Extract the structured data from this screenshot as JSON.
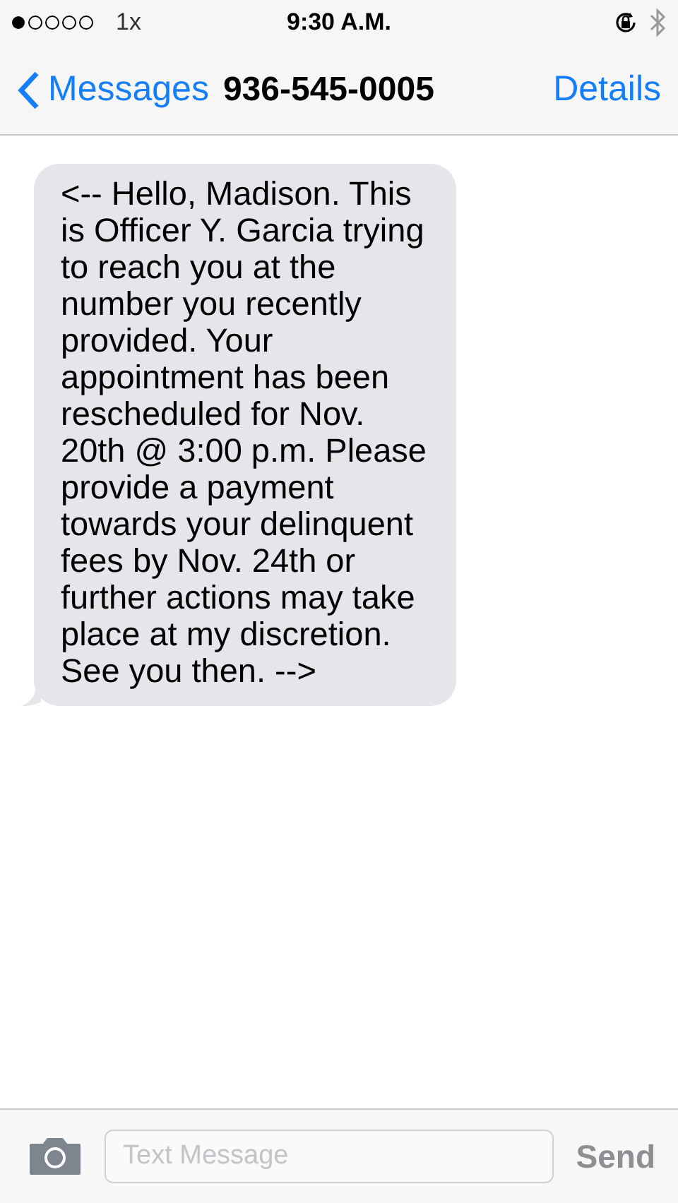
{
  "status_bar": {
    "carrier": "1x",
    "time": "9:30 A.M."
  },
  "nav_bar": {
    "back": "Messages",
    "title": "936-545-0005",
    "action": "Details"
  },
  "messages": [
    {
      "kind": "received",
      "text": "<-- Hello, Madison. This is Officer Y. Garcia trying to reach you at the number you recently provided. Your appointment has been rescheduled for Nov. 20th @ 3:00 p.m. Please provide a payment towards your delinquent fees by Nov. 24th or further actions may take place at my discretion. See you then. -->"
    }
  ],
  "compose": {
    "placeholder": "Text Message",
    "send": {
      "label": "Send",
      "disabled": true
    }
  }
}
